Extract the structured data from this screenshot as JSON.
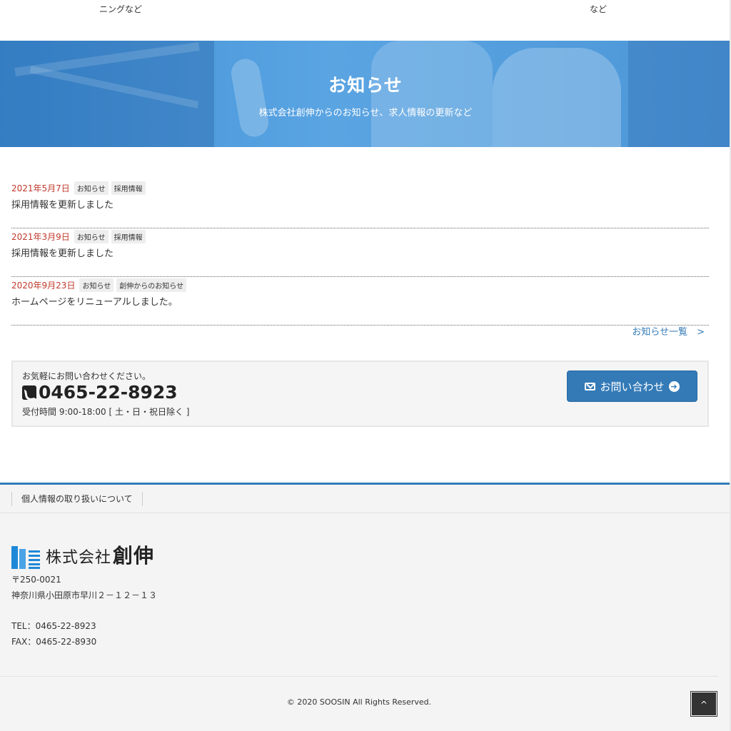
{
  "top_fragments": {
    "left": "ニングなど",
    "right": "など"
  },
  "hero": {
    "title": "お知らせ",
    "subtitle": "株式会社創伸からのお知らせ、求人情報の更新など"
  },
  "news": [
    {
      "date": "2021年5月7日",
      "tags": [
        "お知らせ",
        "採用情報"
      ],
      "title": "採用情報を更新しました"
    },
    {
      "date": "2021年3月9日",
      "tags": [
        "お知らせ",
        "採用情報"
      ],
      "title": "採用情報を更新しました"
    },
    {
      "date": "2020年9月23日",
      "tags": [
        "お知らせ",
        "創伸からのお知らせ"
      ],
      "title": "ホームページをリニューアルしました。"
    }
  ],
  "more_link": "お知らせ一覧　>",
  "contact": {
    "lead": "お気軽にお問い合わせください。",
    "phone": "0465-22-8923",
    "hours": "受付時間 9:00-18:00 [ 土・日・祝日除く ]",
    "button_label": "お問い合わせ",
    "button_arrow": "➔"
  },
  "footer": {
    "nav": [
      "個人情報の取り扱いについて"
    ],
    "logo_text": "株式会社",
    "logo_text_big": "創伸",
    "postal": "〒250-0021",
    "address": "神奈川県小田原市早川２－１２－１３",
    "tel": "TEL：0465-22-8923",
    "fax": "FAX：0465-22-8930",
    "copyright": "© 2020 SOOSIN All Rights Reserved."
  },
  "pagetop_label": "^",
  "colors": {
    "accent": "#337ab7",
    "date": "#c0392b",
    "hero": "#5aa4e2"
  }
}
